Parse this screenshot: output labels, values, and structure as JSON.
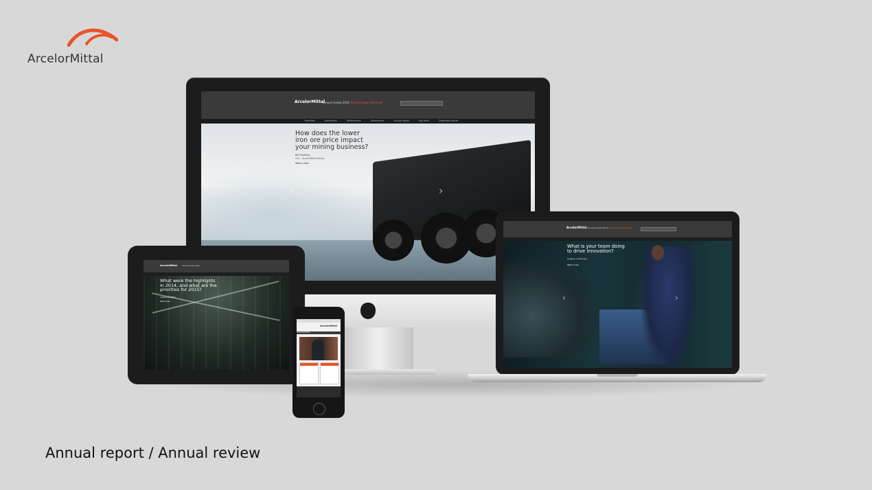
{
  "brand": {
    "name": "ArcelorMittal",
    "logo_color": "#e8532b"
  },
  "caption": "Annual report / Annual review",
  "desktop": {
    "site_logo": "ArcelorMittal",
    "review_label": "Annual review 2014",
    "review_accent": "Transforming tomorrow",
    "nav": [
      "Overview",
      "Operations",
      "Performance",
      "Governance",
      "Annual report",
      "Key facts",
      "Download centre"
    ],
    "hero_question": "How does the lower iron ore price impact your mining business?",
    "hero_name": "Bill Scotting",
    "hero_role": "CEO – ArcelorMittal Mining",
    "hero_link": "Watch video",
    "prev_arrow": "‹",
    "next_arrow": "›"
  },
  "tablet": {
    "site_logo": "ArcelorMittal",
    "review_label": "Annual review 2014",
    "hero_question": "What were the highlights in 2014, and what are the priorities for 2015?",
    "hero_name": "Lakshmi N. Mittal",
    "hero_link": "Watch video"
  },
  "laptop": {
    "site_logo": "ArcelorMittal",
    "review_label": "Annual review 2014",
    "review_accent": "Transforming tomorrow",
    "hero_question": "What is your team doing to drive innovation?",
    "hero_name": "Gregory Ludkovsky",
    "hero_link": "Watch video",
    "prev_arrow": "‹",
    "next_arrow": "›"
  },
  "phone": {
    "site_logo": "ArcelorMittal",
    "menu_label": "Individual films"
  }
}
